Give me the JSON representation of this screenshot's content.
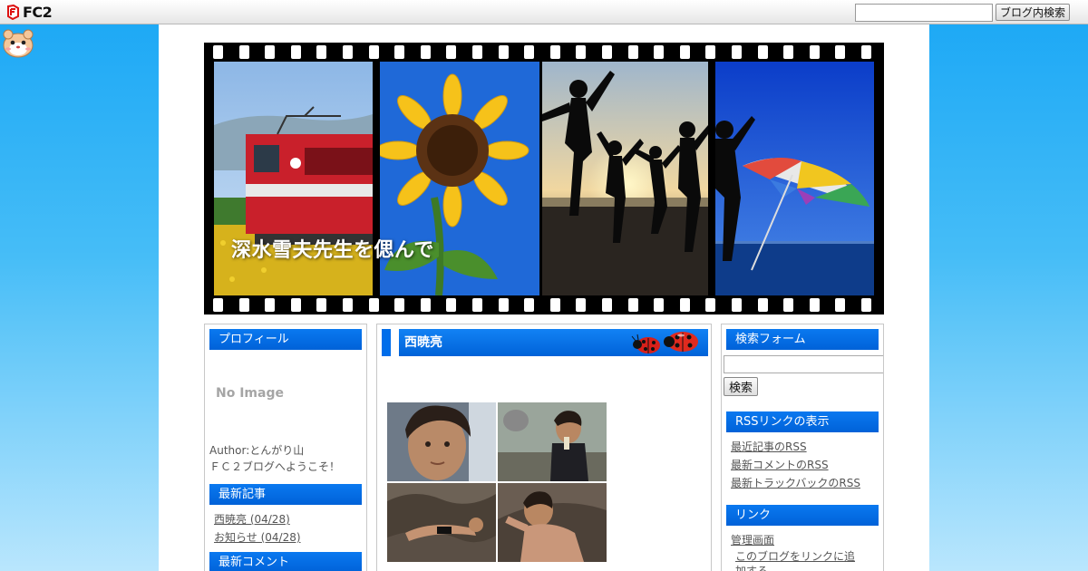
{
  "fc2bar": {
    "logo_text": "FC2",
    "search_placeholder": "",
    "search_button": "ブログ内検索"
  },
  "header": {
    "blog_title": "深水雪夫先生を偲んで"
  },
  "left": {
    "profile_heading": "プロフィール",
    "noimage_text": "No Image",
    "author_line": "Author:とんがり山",
    "welcome_line": "ＦＣ２ブログへようこそ！",
    "recent_heading": "最新記事",
    "recent_items": [
      "西暁亮 (04/28)",
      "お知らせ (04/28)"
    ],
    "next_heading": "最新コメント"
  },
  "main": {
    "entry_title": "西暁亮"
  },
  "right": {
    "search_heading": "検索フォーム",
    "search_button": "検索",
    "rss_heading": "RSSリンクの表示",
    "rss_links": [
      "最近記事のRSS",
      "最新コメントのRSS",
      "最新トラックバックのRSS"
    ],
    "link_heading": "リンク",
    "link_items": [
      "管理画面",
      "このブログをリンクに追",
      "加する"
    ]
  },
  "colors": {
    "accent": "#0a72ee",
    "background_top": "#1aa7f5",
    "background_bottom": "#b9e6fd"
  }
}
